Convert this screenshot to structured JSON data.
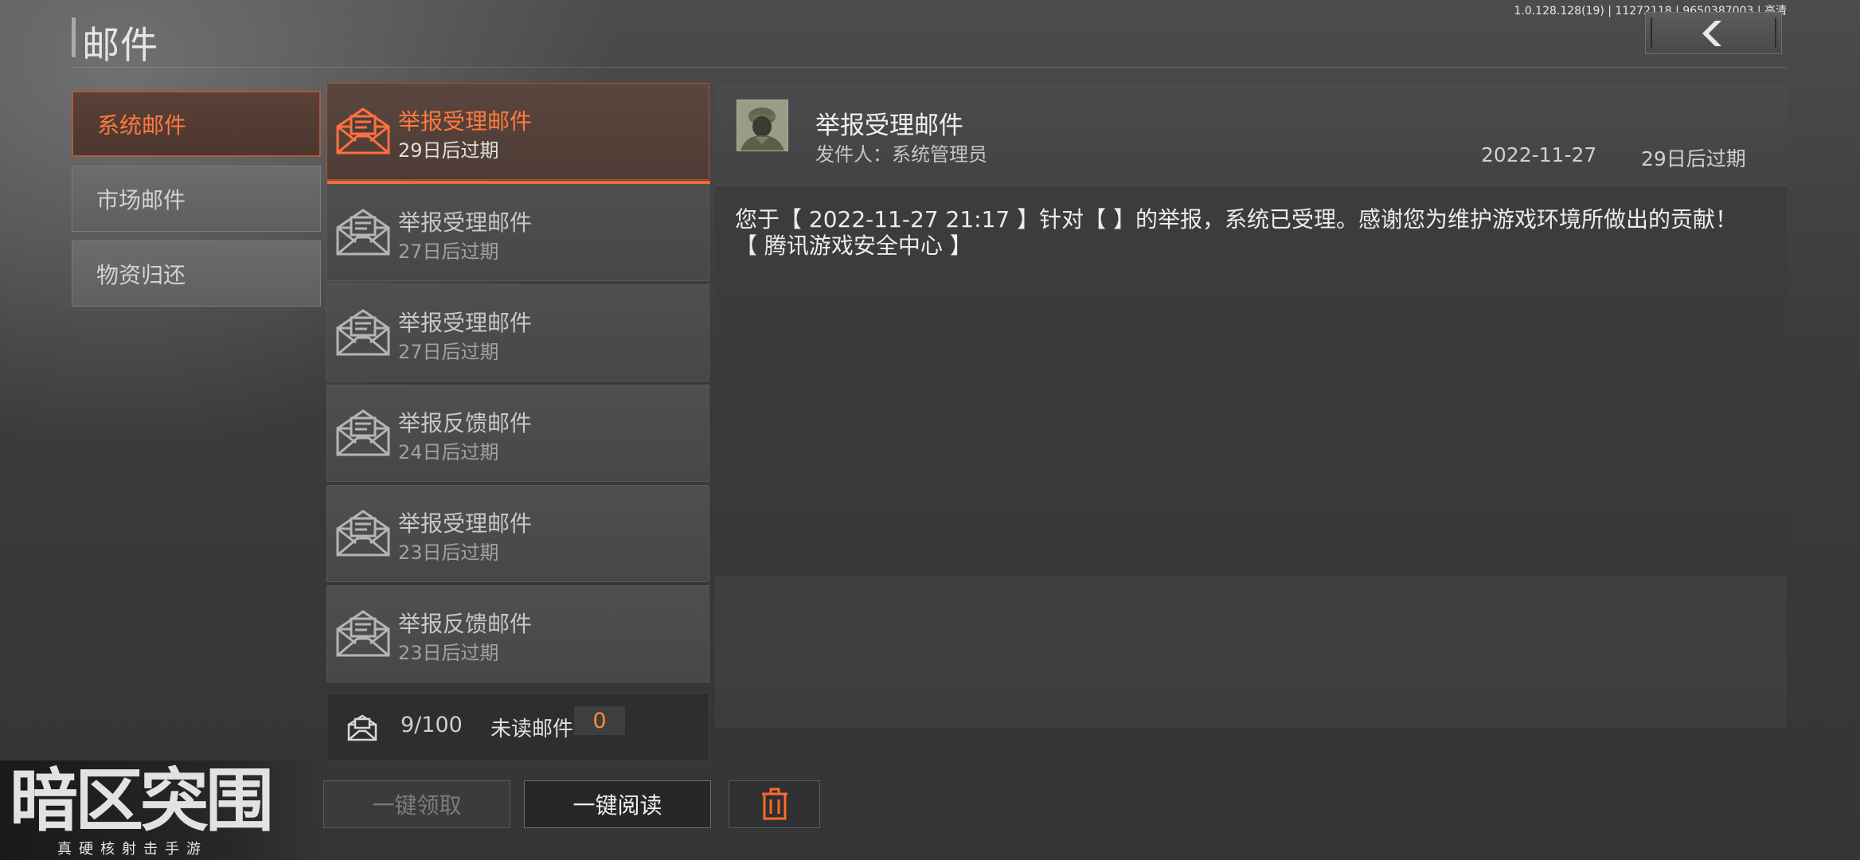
{
  "header": {
    "title": "邮件",
    "version": "1.0.128.128(19) | 11272118 | 9650387003 | 高清"
  },
  "categories": [
    {
      "label": "系统邮件",
      "active": true
    },
    {
      "label": "市场邮件",
      "active": false
    },
    {
      "label": "物资归还",
      "active": false
    }
  ],
  "mails": [
    {
      "title": "举报受理邮件",
      "expire": "29日后过期"
    },
    {
      "title": "举报受理邮件",
      "expire": "27日后过期"
    },
    {
      "title": "举报受理邮件",
      "expire": "27日后过期"
    },
    {
      "title": "举报反馈邮件",
      "expire": "24日后过期"
    },
    {
      "title": "举报受理邮件",
      "expire": "23日后过期"
    },
    {
      "title": "举报反馈邮件",
      "expire": "23日后过期"
    }
  ],
  "list_footer": {
    "count": "9/100",
    "unread_label": "未读邮件",
    "unread_count": "0"
  },
  "detail": {
    "title": "举报受理邮件",
    "sender": "发件人：系统管理员",
    "date": "2022-11-27",
    "expire": "29日后过期",
    "body_line1": "您于【 2022-11-27 21:17 】针对【  】的举报，系统已受理。感谢您为维护游戏环境所做出的贡献！",
    "body_line2": "【 腾讯游戏安全中心 】"
  },
  "buttons": {
    "claim_all": "一键领取",
    "read_all": "一键阅读"
  },
  "logo": {
    "main": "暗区突围",
    "sub": "真硬核射击手游"
  },
  "colors": {
    "accent": "#ff6a2c",
    "accent_text": "#ff7a3e"
  }
}
